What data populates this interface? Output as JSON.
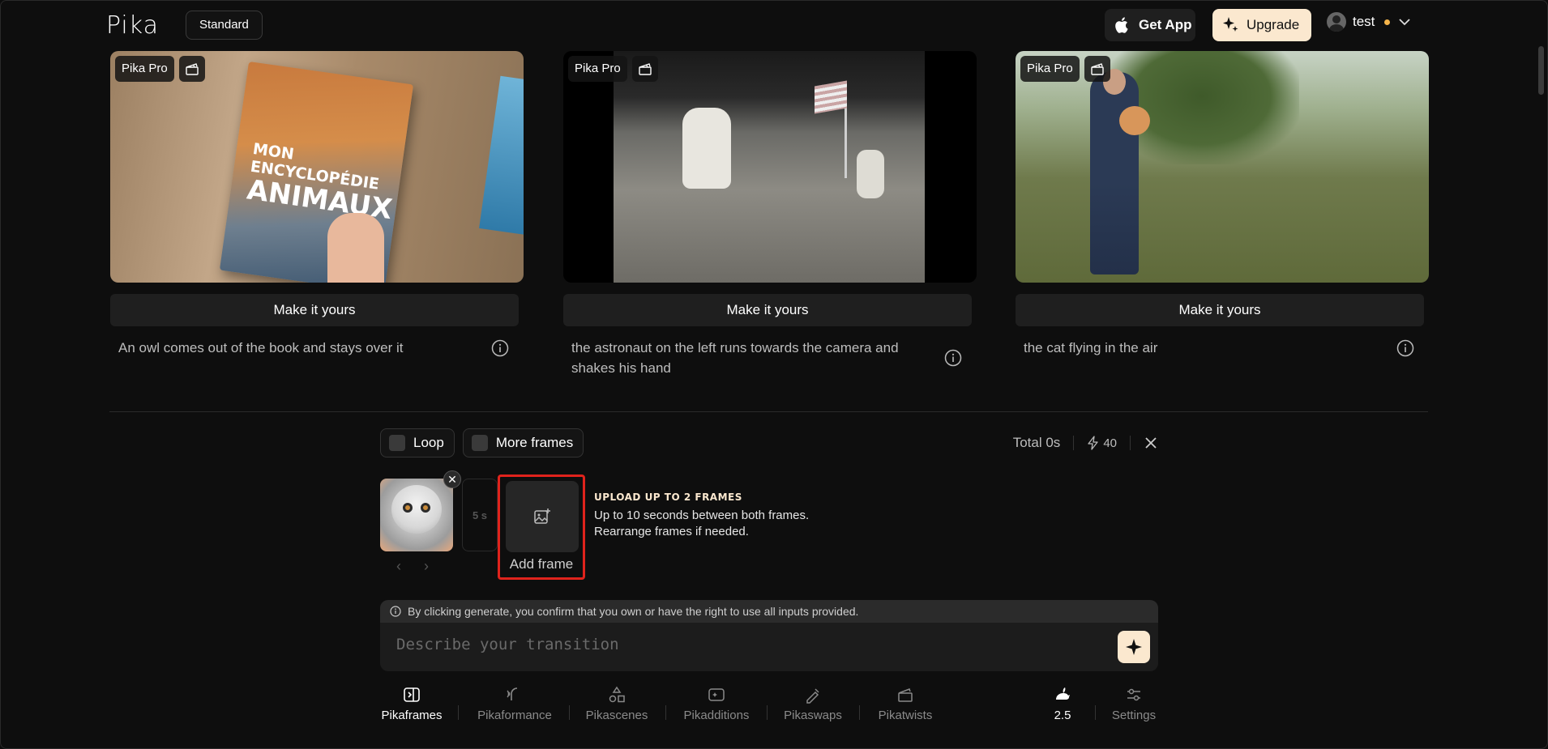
{
  "header": {
    "logo": "Pika",
    "plan": "Standard",
    "get_app": "Get App",
    "upgrade": "Upgrade",
    "username": "test"
  },
  "cards": [
    {
      "badge": "Pika Pro",
      "button": "Make it yours",
      "caption": "An owl comes out of the book and stays over it",
      "book_title_line1": "MON",
      "book_title_line2": "ENCYCLOPÉDIE",
      "book_title_line3": "ANIMAUX"
    },
    {
      "badge": "Pika Pro",
      "button": "Make it yours",
      "caption": "the astronaut on the left runs towards the camera and shakes his hand"
    },
    {
      "badge": "Pika Pro",
      "button": "Make it yours",
      "caption": "the cat flying in the air"
    }
  ],
  "composer": {
    "loop_label": "Loop",
    "more_frames_label": "More frames",
    "total": "Total 0s",
    "credits": "40",
    "duration": "5 s",
    "add_frame": "Add frame",
    "upload_title": "UPLOAD UP TO 2 FRAMES",
    "upload_line1": "Up to 10 seconds between both frames.",
    "upload_line2": "Rearrange frames if needed.",
    "disclaimer": "By clicking generate, you confirm that you own or have the right to use all inputs provided.",
    "placeholder": "Describe your transition"
  },
  "tools": [
    {
      "label": "Pikaframes",
      "icon": "pikaframes-icon"
    },
    {
      "label": "Pikaformance",
      "icon": "pikaformance-icon"
    },
    {
      "label": "Pikascenes",
      "icon": "pikascenes-icon"
    },
    {
      "label": "Pikadditions",
      "icon": "pikadditions-icon"
    },
    {
      "label": "Pikaswaps",
      "icon": "pikaswaps-icon"
    },
    {
      "label": "Pikatwists",
      "icon": "pikatwists-icon"
    }
  ],
  "model": "2.5",
  "settings": "Settings",
  "colors": {
    "accent": "#fbe8cf",
    "highlight": "#e0231c",
    "background": "#0e0e0e"
  }
}
